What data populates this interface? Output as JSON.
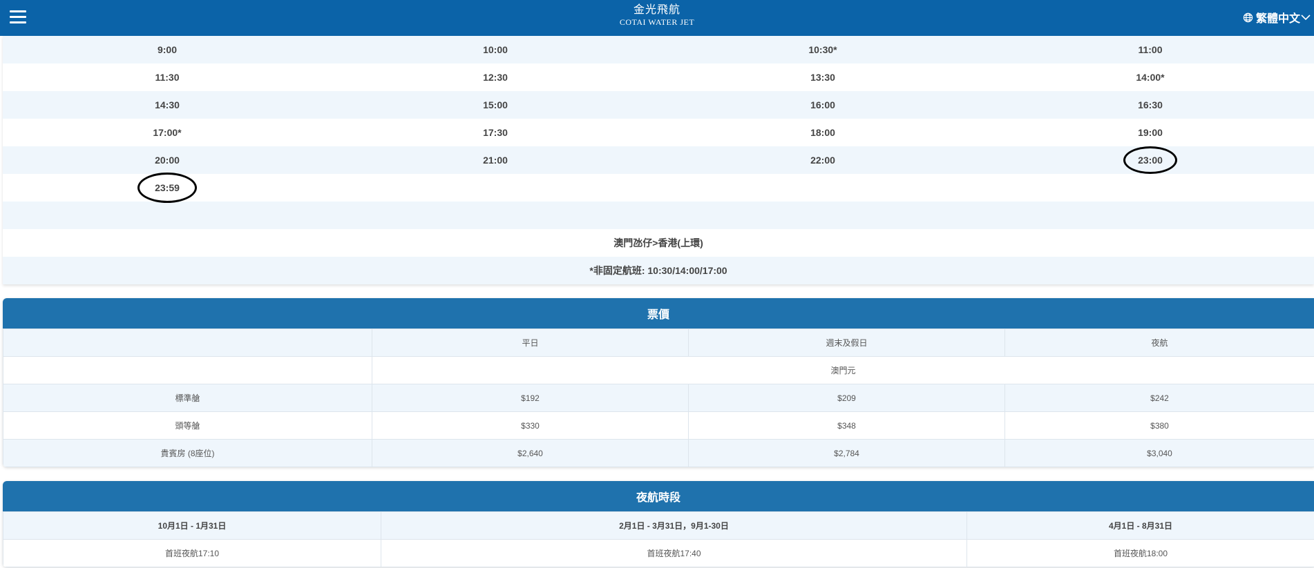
{
  "header": {
    "brand_zh": "金光飛航",
    "brand_en": "COTAI WATER JET",
    "language": "繁體中文"
  },
  "schedule": {
    "rows": [
      [
        "9:00",
        "10:00",
        "10:30*",
        "11:00"
      ],
      [
        "11:30",
        "12:30",
        "13:30",
        "14:00*"
      ],
      [
        "14:30",
        "15:00",
        "16:00",
        "16:30"
      ],
      [
        "17:00*",
        "17:30",
        "18:00",
        "19:00"
      ],
      [
        "20:00",
        "21:00",
        "22:00",
        "23:00"
      ],
      [
        "23:59",
        "",
        "",
        ""
      ]
    ],
    "route": "澳門氹仔>香港(上環)",
    "note": "*非固定航班: 10:30/14:00/17:00"
  },
  "fares": {
    "title": "票價",
    "headers": [
      "",
      "平日",
      "週末及假日",
      "夜航"
    ],
    "currency": "澳門元",
    "rows": [
      [
        "標準艙",
        "$192",
        "$209",
        "$242"
      ],
      [
        "頭等艙",
        "$330",
        "$348",
        "$380"
      ],
      [
        "貴賓房 (8座位)",
        "$2,640",
        "$2,784",
        "$3,040"
      ]
    ]
  },
  "night": {
    "title": "夜航時段",
    "headers": [
      "10月1日 - 1月31日",
      "2月1日 - 3月31日，9月1-30日",
      "4月1日 - 8月31日"
    ],
    "values": [
      "首班夜航17:10",
      "首班夜航17:40",
      "首班夜航18:00"
    ]
  },
  "colors": {
    "header_bg": "#0b63a8",
    "card_title_bg": "#1f72ad",
    "row_alt_bg": "#eff6fc"
  },
  "icons": [
    "menu-icon",
    "globe-icon",
    "chevron-down-icon"
  ]
}
